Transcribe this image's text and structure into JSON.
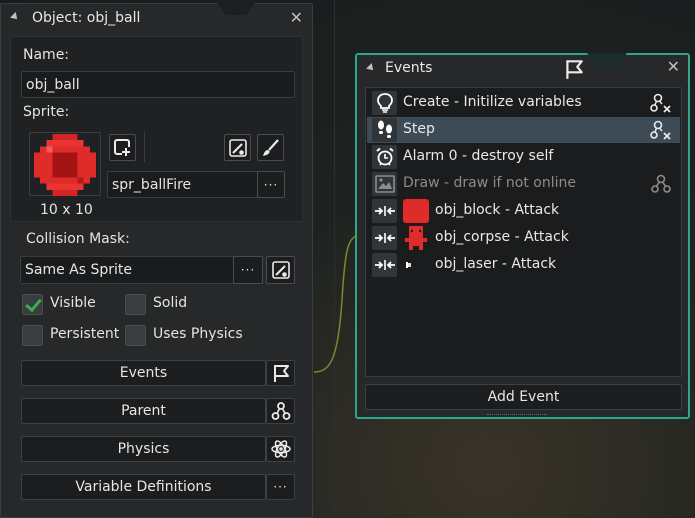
{
  "object_panel": {
    "title": "Object: obj_ball",
    "name_label": "Name:",
    "name_value": "obj_ball",
    "sprite_label": "Sprite:",
    "sprite_name": "spr_ballFire",
    "sprite_size": "10 x 10",
    "collision_label": "Collision Mask:",
    "collision_value": "Same As Sprite",
    "more_label": "···",
    "checkboxes": [
      {
        "label": "Visible",
        "checked": true
      },
      {
        "label": "Solid",
        "checked": false
      },
      {
        "label": "Persistent",
        "checked": false
      },
      {
        "label": "Uses Physics",
        "checked": false
      }
    ],
    "buttons": {
      "events": "Events",
      "parent": "Parent",
      "physics": "Physics",
      "variables": "Variable Definitions"
    }
  },
  "events_panel": {
    "title": "Events",
    "items": [
      {
        "label": "Create - Initilize variables",
        "icon": "lightbulb-icon"
      },
      {
        "label": "Step",
        "icon": "footsteps-icon",
        "selected": true
      },
      {
        "label": "Alarm 0 - destroy self",
        "icon": "alarm-clock-icon"
      },
      {
        "label": "Draw - draw if not online",
        "icon": "draw-icon",
        "disabled": true
      },
      {
        "label": "obj_block - Attack",
        "icon": "collision-icon"
      },
      {
        "label": "obj_corpse - Attack",
        "icon": "collision-icon"
      },
      {
        "label": "obj_laser - Attack",
        "icon": "collision-icon"
      }
    ],
    "add_event_label": "Add Event"
  },
  "colors": {
    "accent": "#2aa889",
    "selection": "#3d4b57",
    "check_green": "#39b04d",
    "sprite_red": "#e02b2b"
  }
}
